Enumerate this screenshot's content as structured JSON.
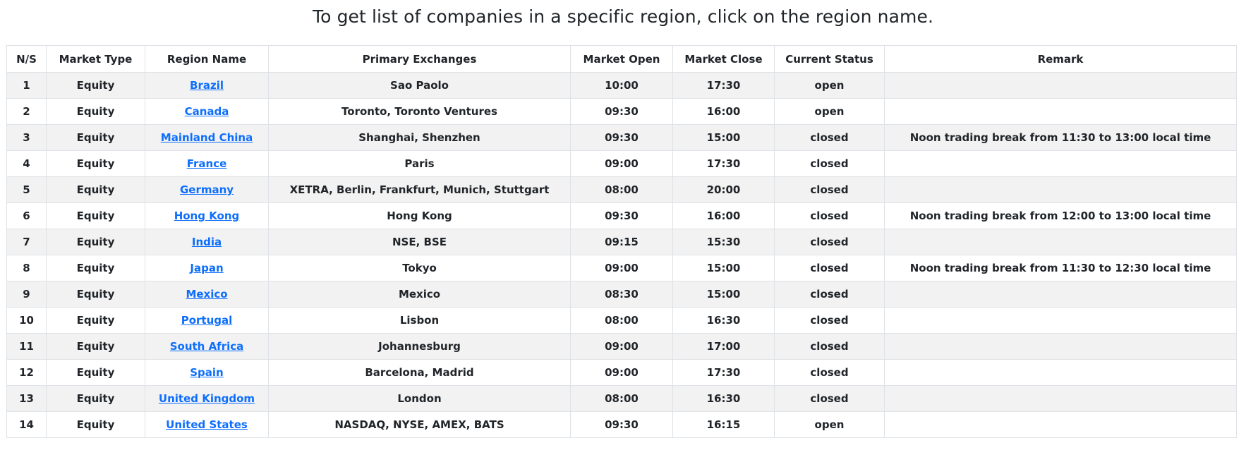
{
  "page": {
    "heading": "To get list of companies in a specific region, click on the region name."
  },
  "table": {
    "columns": [
      "N/S",
      "Market Type",
      "Region Name",
      "Primary Exchanges",
      "Market Open",
      "Market Close",
      "Current Status",
      "Remark"
    ],
    "rows": [
      {
        "ns": "1",
        "market_type": "Equity",
        "region": "Brazil",
        "exchanges": "Sao Paolo",
        "open": "10:00",
        "close": "17:30",
        "status": "open",
        "remark": ""
      },
      {
        "ns": "2",
        "market_type": "Equity",
        "region": "Canada",
        "exchanges": "Toronto, Toronto Ventures",
        "open": "09:30",
        "close": "16:00",
        "status": "open",
        "remark": ""
      },
      {
        "ns": "3",
        "market_type": "Equity",
        "region": "Mainland China",
        "exchanges": "Shanghai, Shenzhen",
        "open": "09:30",
        "close": "15:00",
        "status": "closed",
        "remark": "Noon trading break from 11:30 to 13:00 local time"
      },
      {
        "ns": "4",
        "market_type": "Equity",
        "region": "France",
        "exchanges": "Paris",
        "open": "09:00",
        "close": "17:30",
        "status": "closed",
        "remark": ""
      },
      {
        "ns": "5",
        "market_type": "Equity",
        "region": "Germany",
        "exchanges": "XETRA, Berlin, Frankfurt, Munich, Stuttgart",
        "open": "08:00",
        "close": "20:00",
        "status": "closed",
        "remark": ""
      },
      {
        "ns": "6",
        "market_type": "Equity",
        "region": "Hong Kong",
        "exchanges": "Hong Kong",
        "open": "09:30",
        "close": "16:00",
        "status": "closed",
        "remark": "Noon trading break from 12:00 to 13:00 local time"
      },
      {
        "ns": "7",
        "market_type": "Equity",
        "region": "India",
        "exchanges": "NSE, BSE",
        "open": "09:15",
        "close": "15:30",
        "status": "closed",
        "remark": ""
      },
      {
        "ns": "8",
        "market_type": "Equity",
        "region": "Japan",
        "exchanges": "Tokyo",
        "open": "09:00",
        "close": "15:00",
        "status": "closed",
        "remark": "Noon trading break from 11:30 to 12:30 local time"
      },
      {
        "ns": "9",
        "market_type": "Equity",
        "region": "Mexico",
        "exchanges": "Mexico",
        "open": "08:30",
        "close": "15:00",
        "status": "closed",
        "remark": ""
      },
      {
        "ns": "10",
        "market_type": "Equity",
        "region": "Portugal",
        "exchanges": "Lisbon",
        "open": "08:00",
        "close": "16:30",
        "status": "closed",
        "remark": ""
      },
      {
        "ns": "11",
        "market_type": "Equity",
        "region": "South Africa",
        "exchanges": "Johannesburg",
        "open": "09:00",
        "close": "17:00",
        "status": "closed",
        "remark": ""
      },
      {
        "ns": "12",
        "market_type": "Equity",
        "region": "Spain",
        "exchanges": "Barcelona, Madrid",
        "open": "09:00",
        "close": "17:30",
        "status": "closed",
        "remark": ""
      },
      {
        "ns": "13",
        "market_type": "Equity",
        "region": "United Kingdom",
        "exchanges": "London",
        "open": "08:00",
        "close": "16:30",
        "status": "closed",
        "remark": ""
      },
      {
        "ns": "14",
        "market_type": "Equity",
        "region": "United States",
        "exchanges": "NASDAQ, NYSE, AMEX, BATS",
        "open": "09:30",
        "close": "16:15",
        "status": "open",
        "remark": ""
      }
    ]
  },
  "colors": {
    "link": "#0d6efd",
    "stripe": "#f2f2f2",
    "border": "#dee2e6",
    "text": "#212529"
  }
}
